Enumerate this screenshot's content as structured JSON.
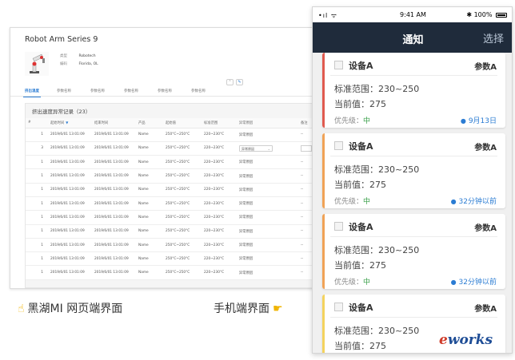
{
  "web": {
    "title": "Robot Arm Series 9",
    "meta": [
      {
        "key": "类型",
        "value": "Robotech"
      },
      {
        "key": "编码",
        "value": "Florida, OL"
      }
    ],
    "tabs": [
      "挤出温度",
      "参数名称",
      "参数名称",
      "参数名称",
      "参数名称",
      "参数名称"
    ],
    "panel_title": "挤出速度异常记录（23）",
    "columns": [
      "#",
      "起始时间",
      "结束时间",
      "产品",
      "起始值",
      "标准范围",
      "异常原因",
      "备注"
    ],
    "rows": [
      {
        "idx": "1",
        "start": "2019/6/01 13:01:09",
        "end": "2019/6/01 13:01:09",
        "product": "Name",
        "init": "250°C~250°C",
        "range": "220~230°C",
        "reason": "异常原因",
        "note": "--"
      },
      {
        "idx": "3",
        "start": "2019/6/01 13:01:09",
        "end": "2019/6/01 13:01:09",
        "product": "Name",
        "init": "250°C~250°C",
        "range": "220~230°C",
        "reason": "异常原因",
        "note": ""
      },
      {
        "idx": "1",
        "start": "2019/6/01 13:01:09",
        "end": "2019/6/01 13:01:09",
        "product": "Name",
        "init": "250°C~250°C",
        "range": "220~230°C",
        "reason": "异常原因",
        "note": "--"
      },
      {
        "idx": "1",
        "start": "2019/6/01 13:01:09",
        "end": "2019/6/01 13:01:09",
        "product": "Name",
        "init": "250°C~250°C",
        "range": "220~230°C",
        "reason": "异常原因",
        "note": "--"
      },
      {
        "idx": "1",
        "start": "2019/6/01 13:01:09",
        "end": "2019/6/01 13:01:09",
        "product": "Name",
        "init": "250°C~250°C",
        "range": "220~230°C",
        "reason": "异常原因",
        "note": "--"
      },
      {
        "idx": "1",
        "start": "2019/6/01 13:01:09",
        "end": "2019/6/01 13:01:09",
        "product": "Name",
        "init": "250°C~250°C",
        "range": "220~230°C",
        "reason": "异常原因",
        "note": "--"
      },
      {
        "idx": "1",
        "start": "2019/6/01 13:01:09",
        "end": "2019/6/01 13:01:09",
        "product": "Name",
        "init": "250°C~250°C",
        "range": "220~230°C",
        "reason": "异常原因",
        "note": "--"
      },
      {
        "idx": "1",
        "start": "2019/6/01 13:01:09",
        "end": "2019/6/01 13:01:09",
        "product": "Name",
        "init": "250°C~250°C",
        "range": "220~230°C",
        "reason": "异常原因",
        "note": "--"
      },
      {
        "idx": "1",
        "start": "2019/6/01 13:01:09",
        "end": "2019/6/01 13:01:09",
        "product": "Name",
        "init": "250°C~250°C",
        "range": "220~230°C",
        "reason": "异常原因",
        "note": "--"
      },
      {
        "idx": "1",
        "start": "2019/6/01 13:01:09",
        "end": "2019/6/01 13:01:09",
        "product": "Name",
        "init": "250°C~250°C",
        "range": "220~230°C",
        "reason": "异常原因",
        "note": "--"
      },
      {
        "idx": "1",
        "start": "2019/6/01 13:01:09",
        "end": "2019/6/01 13:01:09",
        "product": "Name",
        "init": "250°C~250°C",
        "range": "220~230°C",
        "reason": "异常原因",
        "note": "--"
      }
    ]
  },
  "captions": {
    "left": "黑湖MI 网页端界面",
    "right": "手机端界面"
  },
  "phone": {
    "status": {
      "signal": "•ıl ᯤ",
      "time": "9:41 AM",
      "battery": "100%"
    },
    "nav": {
      "title": "通知",
      "action": "选择"
    },
    "cards": [
      {
        "device": "设备A",
        "param": "参数A",
        "range": "标准范围：230~250",
        "current": "当前值：275",
        "priority_label": "优先级：",
        "priority": "中",
        "time": "9月13日",
        "accent": "#e05a4f"
      },
      {
        "device": "设备A",
        "param": "参数A",
        "range": "标准范围：230~250",
        "current": "当前值：275",
        "priority_label": "优先级：",
        "priority": "中",
        "time": "32分钟以前",
        "accent": "#f0a256"
      },
      {
        "device": "设备A",
        "param": "参数A",
        "range": "标准范围：230~250",
        "current": "当前值：275",
        "priority_label": "优先级：",
        "priority": "中",
        "time": "32分钟以前",
        "accent": "#f0a256"
      },
      {
        "device": "设备A",
        "param": "参数A",
        "range": "标准范围：230~250",
        "current": "当前值：275",
        "priority_label": "",
        "priority": "",
        "time": "",
        "accent": "#f4d35e"
      }
    ]
  },
  "watermark": {
    "first": "e",
    "rest": "works"
  },
  "colors": {
    "nav_bg": "#1f2b3b",
    "link_blue": "#2b7cd3",
    "priority_green": "#3aa04a"
  }
}
